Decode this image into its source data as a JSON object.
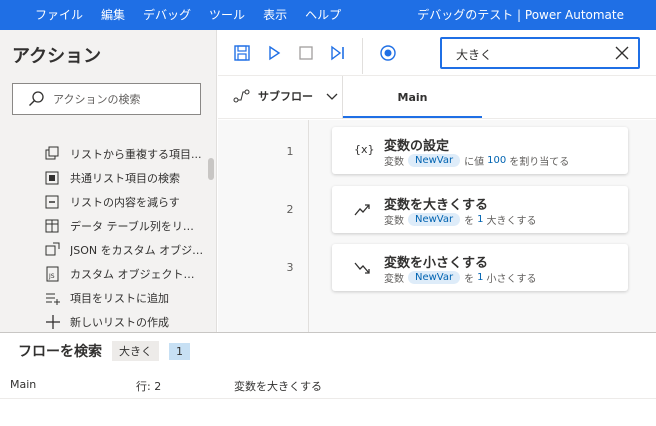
{
  "menu": [
    "ファイル",
    "編集",
    "デバッグ",
    "ツール",
    "表示",
    "ヘルプ"
  ],
  "window_title": "デバッグのテスト | Power Automate",
  "actions_pane": {
    "title": "アクション",
    "search_placeholder": "アクションの検索",
    "items": [
      {
        "label": "リストから重複する項目...",
        "icon": "remove-duplicates-icon"
      },
      {
        "label": "共通リスト項目の検索",
        "icon": "find-common-items-icon"
      },
      {
        "label": "リストの内容を減らす",
        "icon": "subtract-list-icon"
      },
      {
        "label": "データ テーブル列をリスト...",
        "icon": "datatable-icon"
      },
      {
        "label": "JSON をカスタム オブジェ...",
        "icon": "json-convert-icon"
      },
      {
        "label": "カスタム オブジェクトを JS...",
        "icon": "js-object-icon"
      },
      {
        "label": "項目をリストに追加",
        "icon": "add-to-list-icon"
      },
      {
        "label": "新しいリストの作成",
        "icon": "plus-icon"
      }
    ]
  },
  "toolbar": {
    "search_value": "大きく"
  },
  "tabs": {
    "subflow_label": "サブフロー",
    "main_label": "Main"
  },
  "steps": [
    {
      "line": "1",
      "title": "変数の設定",
      "icon_text": "{x}",
      "desc_pre": "変数",
      "var": "NewVar",
      "desc_mid": "に値",
      "value": "100",
      "desc_post": "を割り当てる"
    },
    {
      "line": "2",
      "title": "変数を大きくする",
      "icon_text": "",
      "desc_pre": "変数",
      "var": "NewVar",
      "desc_mid": "を",
      "value": "1",
      "desc_post": "大きくする"
    },
    {
      "line": "3",
      "title": "変数を小さくする",
      "icon_text": "",
      "desc_pre": "変数",
      "var": "NewVar",
      "desc_mid": "を",
      "value": "1",
      "desc_post": "小さくする"
    }
  ],
  "find_panel": {
    "title": "フローを検索",
    "query": "大きく",
    "count": "1",
    "results": [
      {
        "subflow": "Main",
        "line": "行: 2",
        "action": "変数を大きくする"
      }
    ]
  },
  "colors": {
    "accent": "#1f6fe5",
    "var_chip_bg": "#deecf9",
    "var_chip_text": "#0063b1"
  }
}
